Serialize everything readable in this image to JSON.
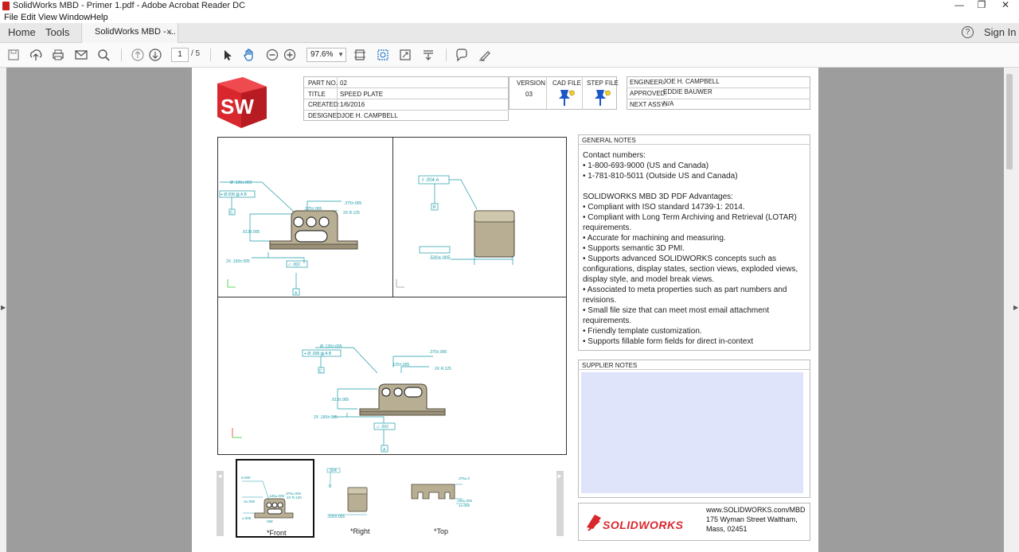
{
  "window": {
    "title": "SolidWorks MBD - Primer 1.pdf - Adobe Acrobat Reader DC",
    "minimize_glyph": "—",
    "restore_glyph": "❐",
    "close_glyph": "✕"
  },
  "menu": [
    "File",
    "Edit",
    "View",
    "Window",
    "Help"
  ],
  "tabs": {
    "home": "Home",
    "tools": "Tools",
    "document": "SolidWorks MBD - ...",
    "close": "×",
    "help_icon": "?",
    "sign_in": "Sign In"
  },
  "toolbar": {
    "page_current": "1",
    "page_total": "/ 5",
    "zoom": "97.6%",
    "zoom_caret": "▼",
    "icons": [
      "save-icon",
      "upload-icon",
      "print-icon",
      "email-icon",
      "search-icon",
      "page-up-icon",
      "page-down-icon",
      "select-arrow-icon",
      "hand-tool-icon",
      "zoom-out-icon",
      "zoom-in-icon",
      "fit-page-icon",
      "marquee-zoom-icon",
      "full-screen-icon",
      "scroll-mode-icon",
      "comment-icon",
      "sign-pen-icon"
    ]
  },
  "header": {
    "logo_text": "SW",
    "part_no_label": "PART NO.",
    "part_no": "02",
    "title_label": "TITLE",
    "title": "SPEED PLATE",
    "created_label": "CREATED:",
    "created": "1/6/2016",
    "designed_label": "DESIGNED:",
    "designed": "JOE H. CAMPBELL",
    "version_label": "VERSION",
    "version": "03",
    "cad_file_label": "CAD FILE",
    "step_file_label": "STEP FILE",
    "engineer_label": "ENGINEER:",
    "engineer": "JOE H. CAMPBELL",
    "approved_label": "APPROVED:",
    "approved": "EDDIE BAUWER",
    "next_assy_label": "NEXT ASSY:",
    "next_assy": "N/A"
  },
  "views": {
    "front_dims": {
      "d1": "Ø .126±.005",
      "fcf1": "⌖ Ø.008 Ⓜ A B",
      "d2": ".375±.005",
      "d3": ".125±.005",
      "d4": "2X R.125",
      "d5": ".613±.005",
      "d6": "2X .190±.005",
      "fcf2": "⏥ .002",
      "datum_a": "A",
      "datum_c": "C"
    },
    "right_dims": {
      "fcf": "⫽ .004 A",
      "datum_b": "B",
      "width": ".530±.005"
    },
    "top_dims": {
      "d1": "Ø .126±.005",
      "fcf1": "⌖ Ø .008 Ⓜ A B",
      "d2": ".375±.005",
      "d3": ".125±.005",
      "d4": "2X R.125",
      "d5": ".613±.005",
      "d6": "2X .190±.005",
      "fcf2": "⏥ .002",
      "datum_a": "A",
      "datum_c": "C"
    }
  },
  "thumbnails": [
    {
      "label": "*Front",
      "selected": true
    },
    {
      "label": "*Right",
      "selected": false
    },
    {
      "label": "*Top",
      "selected": false
    }
  ],
  "thumb_nav": {
    "prev": "◄",
    "next": "►"
  },
  "general_notes": {
    "header": "GENERAL NOTES",
    "lines": [
      "Contact numbers:",
      "• 1-800-693-9000 (US and Canada)",
      "• 1-781-810-5011 (Outside US and Canada)",
      "",
      "SOLIDWORKS MBD 3D PDF Advantages:",
      "• Compliant with ISO standard 14739-1: 2014.",
      "• Compliant with Long Term Archiving and Retrieval (LOTAR)",
      "requirements.",
      "• Accurate for machining and measuring.",
      "• Supports semantic 3D PMI.",
      "• Supports advanced SOLIDWORKS concepts such as",
      "configurations, display states, section views, exploded views,",
      "display style, and model break views.",
      "• Associated to meta properties such as part numbers and",
      "revisions.",
      "• Small file size that can meet most email attachment",
      "requirements.",
      "• Friendly template customization.",
      "• Supports fillable form fields for direct in-context"
    ]
  },
  "supplier_notes": {
    "header": "SUPPLIER NOTES"
  },
  "footer": {
    "brand": "SOLIDWORKS",
    "brand_mark": "3DS",
    "url": "www.SOLIDWORKS.com/MBD",
    "address1": "175 Wyman Street Waltham,",
    "address2": "Mass, 02451"
  },
  "colors": {
    "accent_cyan": "#1a9aa8",
    "part_fill": "#b8ae94",
    "supplier_fill": "#dfe4fb",
    "logo_red": "#d9272e",
    "pin_blue": "#1a56c8"
  }
}
